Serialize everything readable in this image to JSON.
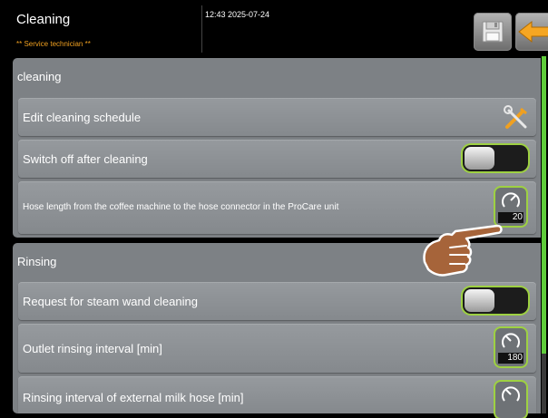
{
  "header": {
    "title": "Cleaning",
    "subtitle": "** Service technician **",
    "datetime": "12:43 2025-07-24",
    "save_icon": "floppy-disk-icon",
    "back_icon": "back-arrow-icon"
  },
  "sections": [
    {
      "title": "cleaning",
      "rows": [
        {
          "label": "Edit cleaning schedule",
          "control": "tools-icon"
        },
        {
          "label": "Switch off after cleaning",
          "control": "toggle",
          "state": "off"
        },
        {
          "label": "Hose length from the coffee machine to the hose connector in the ProCare unit",
          "control": "dial",
          "value": "20"
        }
      ]
    },
    {
      "title": "Rinsing",
      "rows": [
        {
          "label": "Request for steam wand cleaning",
          "control": "toggle",
          "state": "off"
        },
        {
          "label": "Outlet rinsing interval [min]",
          "control": "dial",
          "value": "180"
        },
        {
          "label": "Rinsing interval of external milk hose [min]",
          "control": "dial",
          "value": ""
        }
      ]
    }
  ],
  "colors": {
    "accent": "#9ed142",
    "scrollbar": "#5fcc3a",
    "subtitle": "#f0a020",
    "back_arrow": "#f5a623",
    "panel": "#7d8185"
  },
  "overlay": {
    "icon": "pointing-hand-icon"
  }
}
